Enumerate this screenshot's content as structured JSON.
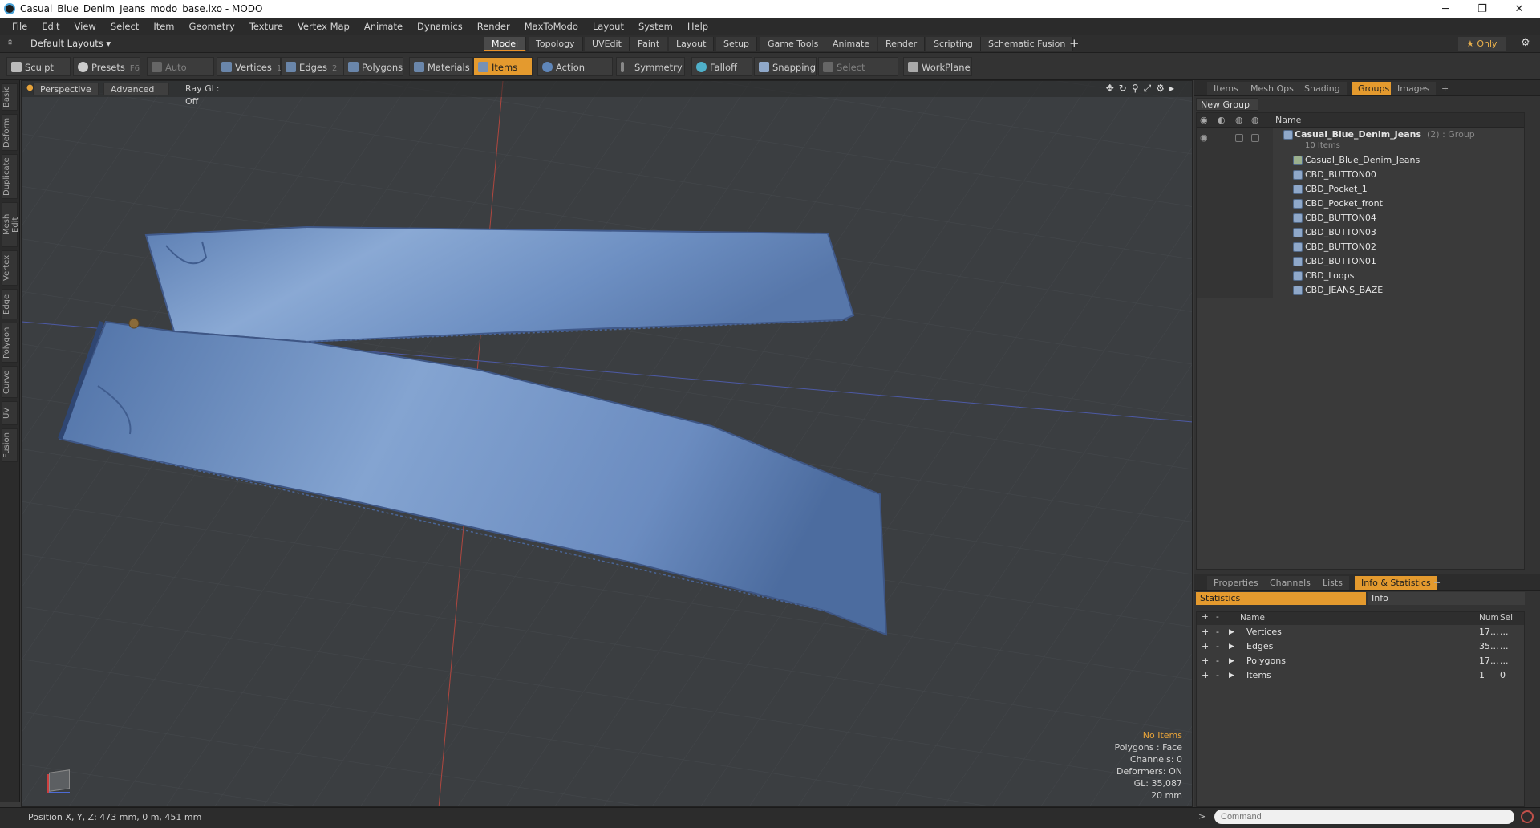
{
  "window": {
    "title": "Casual_Blue_Denim_Jeans_modo_base.lxo - MODO",
    "minimize": "─",
    "maximize": "❐",
    "close": "✕"
  },
  "menu": [
    "File",
    "Edit",
    "View",
    "Select",
    "Item",
    "Geometry",
    "Texture",
    "Vertex Map",
    "Animate",
    "Dynamics",
    "Render",
    "MaxToModo",
    "Layout",
    "System",
    "Help"
  ],
  "layouts": {
    "selector": "Default Layouts ▾",
    "tabs": [
      "Model",
      "Topology",
      "UVEdit",
      "Paint",
      "Layout",
      "Setup",
      "Game Tools",
      "Animate",
      "Render",
      "Scripting",
      "Schematic Fusion"
    ],
    "active": "Model",
    "only": "★  Only"
  },
  "toolbar": {
    "sculpt": "Sculpt",
    "presets": "Presets",
    "presets_key": "F6",
    "auto_select": "Auto Select",
    "vertices": "Vertices",
    "vertices_num": "1",
    "edges": "Edges",
    "edges_num": "2",
    "polygons": "Polygons",
    "materials": "Materials",
    "items": "Items",
    "action_center": "Action Center",
    "symmetry": "Symmetry",
    "falloff": "Falloff",
    "snapping": "Snapping",
    "select_through": "Select Through",
    "workplane": "WorkPlane"
  },
  "left_tabs": [
    "Basic",
    "Deform",
    "Duplicate",
    "Mesh Edit",
    "Vertex",
    "Edge",
    "Polygon",
    "Curve",
    "UV",
    "Fusion"
  ],
  "viewport": {
    "view": "Perspective",
    "shading": "Advanced",
    "raygl": "Ray GL: Off",
    "hud": {
      "no_items": "No Items",
      "polygons": "Polygons : Face",
      "channels": "Channels: 0",
      "deformers": "Deformers: ON",
      "gl": "GL: 35,087",
      "scale": "20 mm"
    }
  },
  "status": "Position X, Y, Z:   473 mm, 0 m, 451 mm",
  "items_panel": {
    "tabs": [
      "Items",
      "Mesh Ops",
      "Shading",
      "Groups",
      "Images"
    ],
    "active": "Groups",
    "new_group": "New Group",
    "col_name": "Name",
    "group": {
      "name": "Casual_Blue_Denim_Jeans",
      "suffix": " (2) : Group",
      "count": "10 Items"
    },
    "children": [
      "Casual_Blue_Denim_Jeans",
      "CBD_BUTTON00",
      "CBD_Pocket_1",
      "CBD_Pocket_front",
      "CBD_BUTTON04",
      "CBD_BUTTON03",
      "CBD_BUTTON02",
      "CBD_BUTTON01",
      "CBD_Loops",
      "CBD_JEANS_BAZE"
    ]
  },
  "props_panel": {
    "tabs": [
      "Properties",
      "Channels",
      "Lists",
      "Info & Statistics"
    ],
    "active": "Info & Statistics",
    "subtabs": [
      "Statistics",
      "Info"
    ],
    "cols": {
      "name": "Name",
      "num": "Num",
      "sel": "Sel"
    },
    "rows": [
      {
        "name": "Vertices",
        "num": "17...",
        "sel": "..."
      },
      {
        "name": "Edges",
        "num": "35...",
        "sel": "..."
      },
      {
        "name": "Polygons",
        "num": "17...",
        "sel": "..."
      },
      {
        "name": "Items",
        "num": "1",
        "sel": "0"
      }
    ]
  },
  "command": {
    "placeholder": "Command"
  },
  "colors": {
    "accent": "#e49a2e",
    "denim": "#6f92c4"
  }
}
